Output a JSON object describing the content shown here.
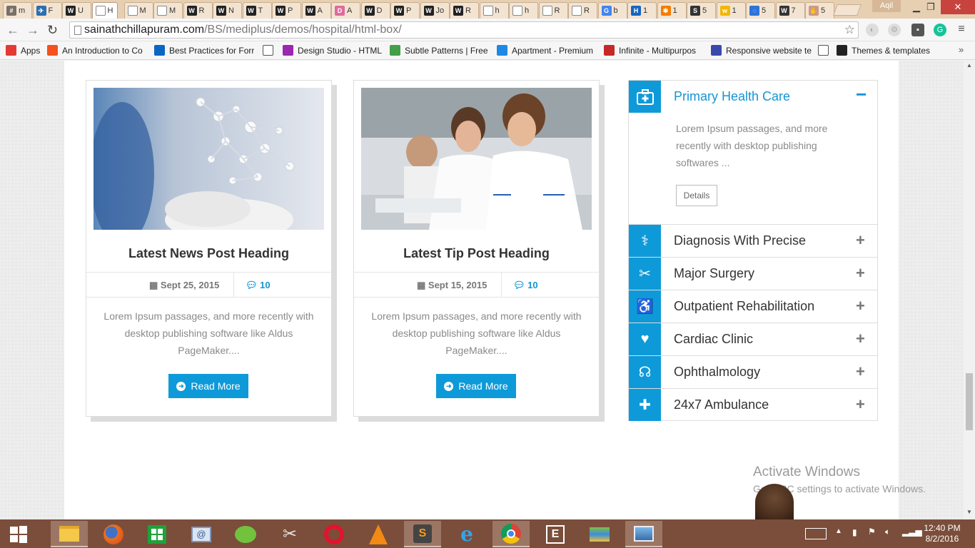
{
  "browser": {
    "tabs": [
      {
        "label": "m",
        "color": "#7a6f65",
        "glyph": "#"
      },
      {
        "label": "F",
        "color": "#2a6fb3",
        "glyph": "✈"
      },
      {
        "label": "U",
        "color": "#222",
        "glyph": "W"
      },
      {
        "label": "H",
        "color": "#fff",
        "glyph": ""
      },
      {
        "label": "M",
        "color": "#fff",
        "glyph": ""
      },
      {
        "label": "M",
        "color": "#fff",
        "glyph": ""
      },
      {
        "label": "R",
        "color": "#222",
        "glyph": "W"
      },
      {
        "label": "N",
        "color": "#222",
        "glyph": "W"
      },
      {
        "label": "T",
        "color": "#222",
        "glyph": "W"
      },
      {
        "label": "P",
        "color": "#222",
        "glyph": "W"
      },
      {
        "label": "A",
        "color": "#222",
        "glyph": "W"
      },
      {
        "label": "A",
        "color": "#e06b9a",
        "glyph": "D"
      },
      {
        "label": "D",
        "color": "#222",
        "glyph": "W"
      },
      {
        "label": "P",
        "color": "#222",
        "glyph": "W"
      },
      {
        "label": "Jo",
        "color": "#222",
        "glyph": "W"
      },
      {
        "label": "R",
        "color": "#222",
        "glyph": "W"
      },
      {
        "label": "h",
        "color": "#fff",
        "glyph": ""
      },
      {
        "label": "h",
        "color": "#fff",
        "glyph": ""
      },
      {
        "label": "R",
        "color": "#fff",
        "glyph": ""
      },
      {
        "label": "R",
        "color": "#fff",
        "glyph": ""
      },
      {
        "label": "b",
        "color": "#4285f4",
        "glyph": "G"
      },
      {
        "label": "1",
        "color": "#1565c0",
        "glyph": "H"
      },
      {
        "label": "1",
        "color": "#f57c00",
        "glyph": "✱"
      },
      {
        "label": "5",
        "color": "#333",
        "glyph": "S"
      },
      {
        "label": "1",
        "color": "#f2b705",
        "glyph": "w"
      },
      {
        "label": "5",
        "color": "#2d74d8",
        "glyph": "◌"
      },
      {
        "label": "7",
        "color": "#333",
        "glyph": "W"
      },
      {
        "label": "5",
        "color": "#c98",
        "glyph": "✋"
      }
    ],
    "active_tab_label": "H",
    "active_tab_close": "✕",
    "profile_name": "Aqil",
    "url_host": "sainathchillapuram.com",
    "url_path": "/BS/mediplus/demos/hospital/html-box/",
    "bookmarks": [
      {
        "label": "Apps",
        "color": "#e53935",
        "icon": "apps-icon"
      },
      {
        "label": "An Introduction to Co",
        "color": "#f4511e",
        "icon": "plus-icon"
      },
      {
        "label": "Best Practices for Forr",
        "color": "#0a66c2",
        "icon": "linkedin-icon"
      },
      {
        "label": "",
        "color": "#fff",
        "icon": "page-icon"
      },
      {
        "label": "Design Studio - HTML",
        "color": "#9c27b0",
        "icon": "d-icon"
      },
      {
        "label": "Subtle Patterns | Free",
        "color": "#43a047",
        "icon": "pattern-icon"
      },
      {
        "label": "Apartment - Premium",
        "color": "#1e88e5",
        "icon": "home-icon"
      },
      {
        "label": "Infinite - Multipurpos",
        "color": "#c62828",
        "icon": "wp-icon"
      },
      {
        "label": "Responsive website te",
        "color": "#3949ab",
        "icon": "shield-icon"
      },
      {
        "label": "",
        "color": "#fff",
        "icon": "page-icon"
      },
      {
        "label": "Themes & templates",
        "color": "#222",
        "icon": "w-icon"
      }
    ]
  },
  "cards": [
    {
      "title": "Latest News Post Heading",
      "date": "Sept 25, 2015",
      "comments": "10",
      "excerpt": "Lorem Ipsum passages, and more recently with desktop publishing software like Aldus PageMaker....",
      "button": "Read More"
    },
    {
      "title": "Latest Tip Post Heading",
      "date": "Sept 15, 2015",
      "comments": "10",
      "excerpt": "Lorem Ipsum passages, and more recently with desktop publishing software like Aldus PageMaker....",
      "button": "Read More"
    }
  ],
  "accordion": {
    "open": {
      "title": "Primary Health Care",
      "body": "Lorem Ipsum passages, and more recently with desktop publishing softwares ...",
      "button": "Details",
      "toggle": "−"
    },
    "items": [
      {
        "title": "Diagnosis With Precise",
        "icon": "doctor-icon",
        "glyph": "⚕"
      },
      {
        "title": "Major Surgery",
        "icon": "scissors-icon",
        "glyph": "✂"
      },
      {
        "title": "Outpatient Rehabilitation",
        "icon": "wheelchair-icon",
        "glyph": "♿"
      },
      {
        "title": "Cardiac Clinic",
        "icon": "heartbeat-icon",
        "glyph": "♥"
      },
      {
        "title": "Ophthalmology",
        "icon": "stethoscope-icon",
        "glyph": "☊"
      },
      {
        "title": "24x7 Ambulance",
        "icon": "ambulance-icon",
        "glyph": "✚"
      }
    ],
    "toggle": "+"
  },
  "watermark": {
    "line1": "Activate Windows",
    "line2": "Go to PC settings to activate Windows."
  },
  "taskbar": {
    "time": "12:40 PM",
    "date": "8/2/2016"
  }
}
